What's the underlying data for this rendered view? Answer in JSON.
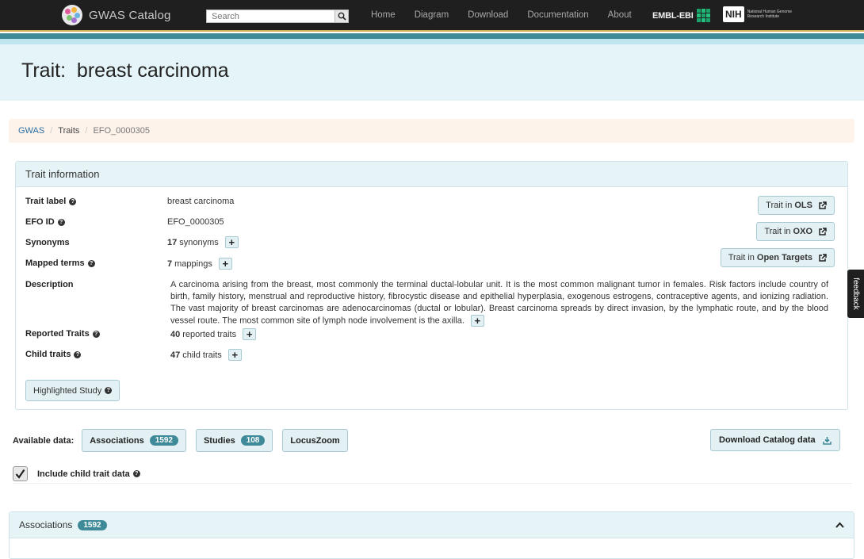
{
  "nav": {
    "brand": "GWAS Catalog",
    "search_placeholder": "Search",
    "links": [
      "Home",
      "Diagram",
      "Download",
      "Documentation",
      "About"
    ],
    "ebi": "EMBL-EBI",
    "nih": "NIH",
    "nih_sub": "National Human Genome Research Institute"
  },
  "hero": {
    "title": "Trait:  breast carcinoma"
  },
  "breadcrumb": {
    "root": "GWAS",
    "traits": "Traits",
    "current": "EFO_0000305"
  },
  "trait_info": {
    "heading": "Trait information",
    "labels": {
      "trait_label": "Trait label",
      "efo_id": "EFO ID",
      "synonyms": "Synonyms",
      "mapped_terms": "Mapped terms",
      "description": "Description",
      "reported_traits": "Reported Traits",
      "child_traits": "Child traits"
    },
    "values": {
      "trait_label": "breast carcinoma",
      "efo_id": "EFO_0000305",
      "synonyms_count": "17",
      "synonyms_text": "synonyms",
      "mappings_count": "7",
      "mappings_text": "mappings",
      "description": "A carcinoma arising from the breast, most commonly the terminal ductal-lobular unit. It is the most common malignant tumor in females. Risk factors include country of birth, family history, menstrual and reproductive history, fibrocystic disease and epithelial hyperplasia, exogenous estrogens, contraceptive agents, and ionizing radiation. The vast majority of breast carcinomas are adenocarcinomas (ductal or lobular). Breast carcinoma spreads by direct invasion, by the lymphatic route, and by the blood vessel route. The most common site of lymph node involvement is the axilla.",
      "reported_count": "40",
      "reported_text": "reported traits",
      "child_count": "47",
      "child_text": "child traits"
    },
    "buttons": {
      "ols_prefix": "Trait in",
      "ols": "OLS",
      "oxo_prefix": "Trait in",
      "oxo": "OXO",
      "ot_prefix": "Trait in",
      "ot": "Open Targets"
    },
    "highlighted_study": "Highlighted Study"
  },
  "available": {
    "label": "Available data:",
    "associations": "Associations",
    "associations_count": "1592",
    "studies": "Studies",
    "studies_count": "108",
    "locuszoom": "LocusZoom",
    "download": "Download Catalog data"
  },
  "include_child": "Include child trait data",
  "associations_panel": {
    "title": "Associations",
    "count": "1592"
  },
  "feedback": "feedback",
  "colors": {
    "teal": "#3f8a99",
    "navbar": "#1f1f1f",
    "accent": "#d9b25f"
  }
}
